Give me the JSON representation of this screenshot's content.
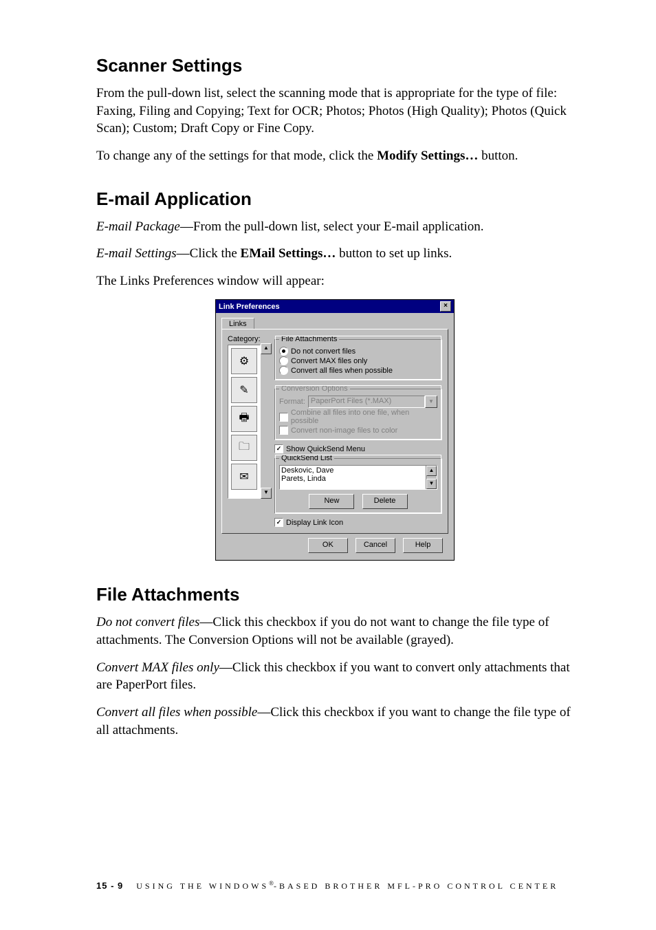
{
  "sections": {
    "scanner": {
      "heading": "Scanner Settings",
      "p1": "From the pull-down list, select the scanning mode that is appropriate for the type of file: Faxing, Filing and Copying; Text for OCR; Photos; Photos (High Quality); Photos (Quick Scan); Custom; Draft Copy or Fine Copy.",
      "p2_pre": "To change any of the settings for that mode, click the ",
      "p2_bold": "Modify Settings…",
      "p2_post": " button."
    },
    "email": {
      "heading": "E-mail Application",
      "p1_em": "E-mail Package",
      "p1_rest": "—From the pull-down list, select your E-mail application.",
      "p2_em": "E-mail Settings",
      "p2_mid": "—Click the ",
      "p2_bold": "EMail Settings…",
      "p2_post": " button to set up links.",
      "p3": "The Links Preferences window will appear:"
    },
    "fileatt": {
      "heading": "File Attachments",
      "p1_em": "Do not convert files",
      "p1_rest": "—Click this checkbox if you do not want to change the file type of attachments. The Conversion Options will not be available (grayed).",
      "p2_em": "Convert MAX files only",
      "p2_rest": "—Click this checkbox if you want to convert only attachments that are PaperPort files.",
      "p3_em": "Convert all files when possible",
      "p3_rest": "—Click this checkbox if you want to change the file type of all attachments."
    }
  },
  "dialog": {
    "title": "Link Preferences",
    "close_glyph": "×",
    "tab_label": "Links",
    "category_label": "Category:",
    "cat_icons": [
      "⚙",
      "✎",
      "🖶",
      "🗀",
      "✉"
    ],
    "scroll_up": "▲",
    "scroll_dn": "▼",
    "grp_file": {
      "legend": "File Attachments",
      "r1": "Do not convert files",
      "r2": "Convert MAX files only",
      "r3": "Convert all files when possible"
    },
    "grp_conv": {
      "legend": "Conversion Options",
      "format_label": "Format:",
      "format_value": "PaperPort Files (*.MAX)",
      "c1": "Combine all files into one file, when possible",
      "c2": "Convert non-image files to color"
    },
    "show_quicksend": "Show QuickSend Menu",
    "grp_qs": {
      "legend": "QuickSend List",
      "items": [
        "Deskovic, Dave",
        "Parets, Linda"
      ],
      "btn_new": "New",
      "btn_delete": "Delete"
    },
    "display_link_icon": "Display Link Icon",
    "btn_ok": "OK",
    "btn_cancel": "Cancel",
    "btn_help": "Help"
  },
  "footer": {
    "page": "15 - 9",
    "text_pre": "USING THE WINDOWS",
    "reg": "®",
    "text_post": "-BASED BROTHER MFL-PRO CONTROL CENTER"
  }
}
